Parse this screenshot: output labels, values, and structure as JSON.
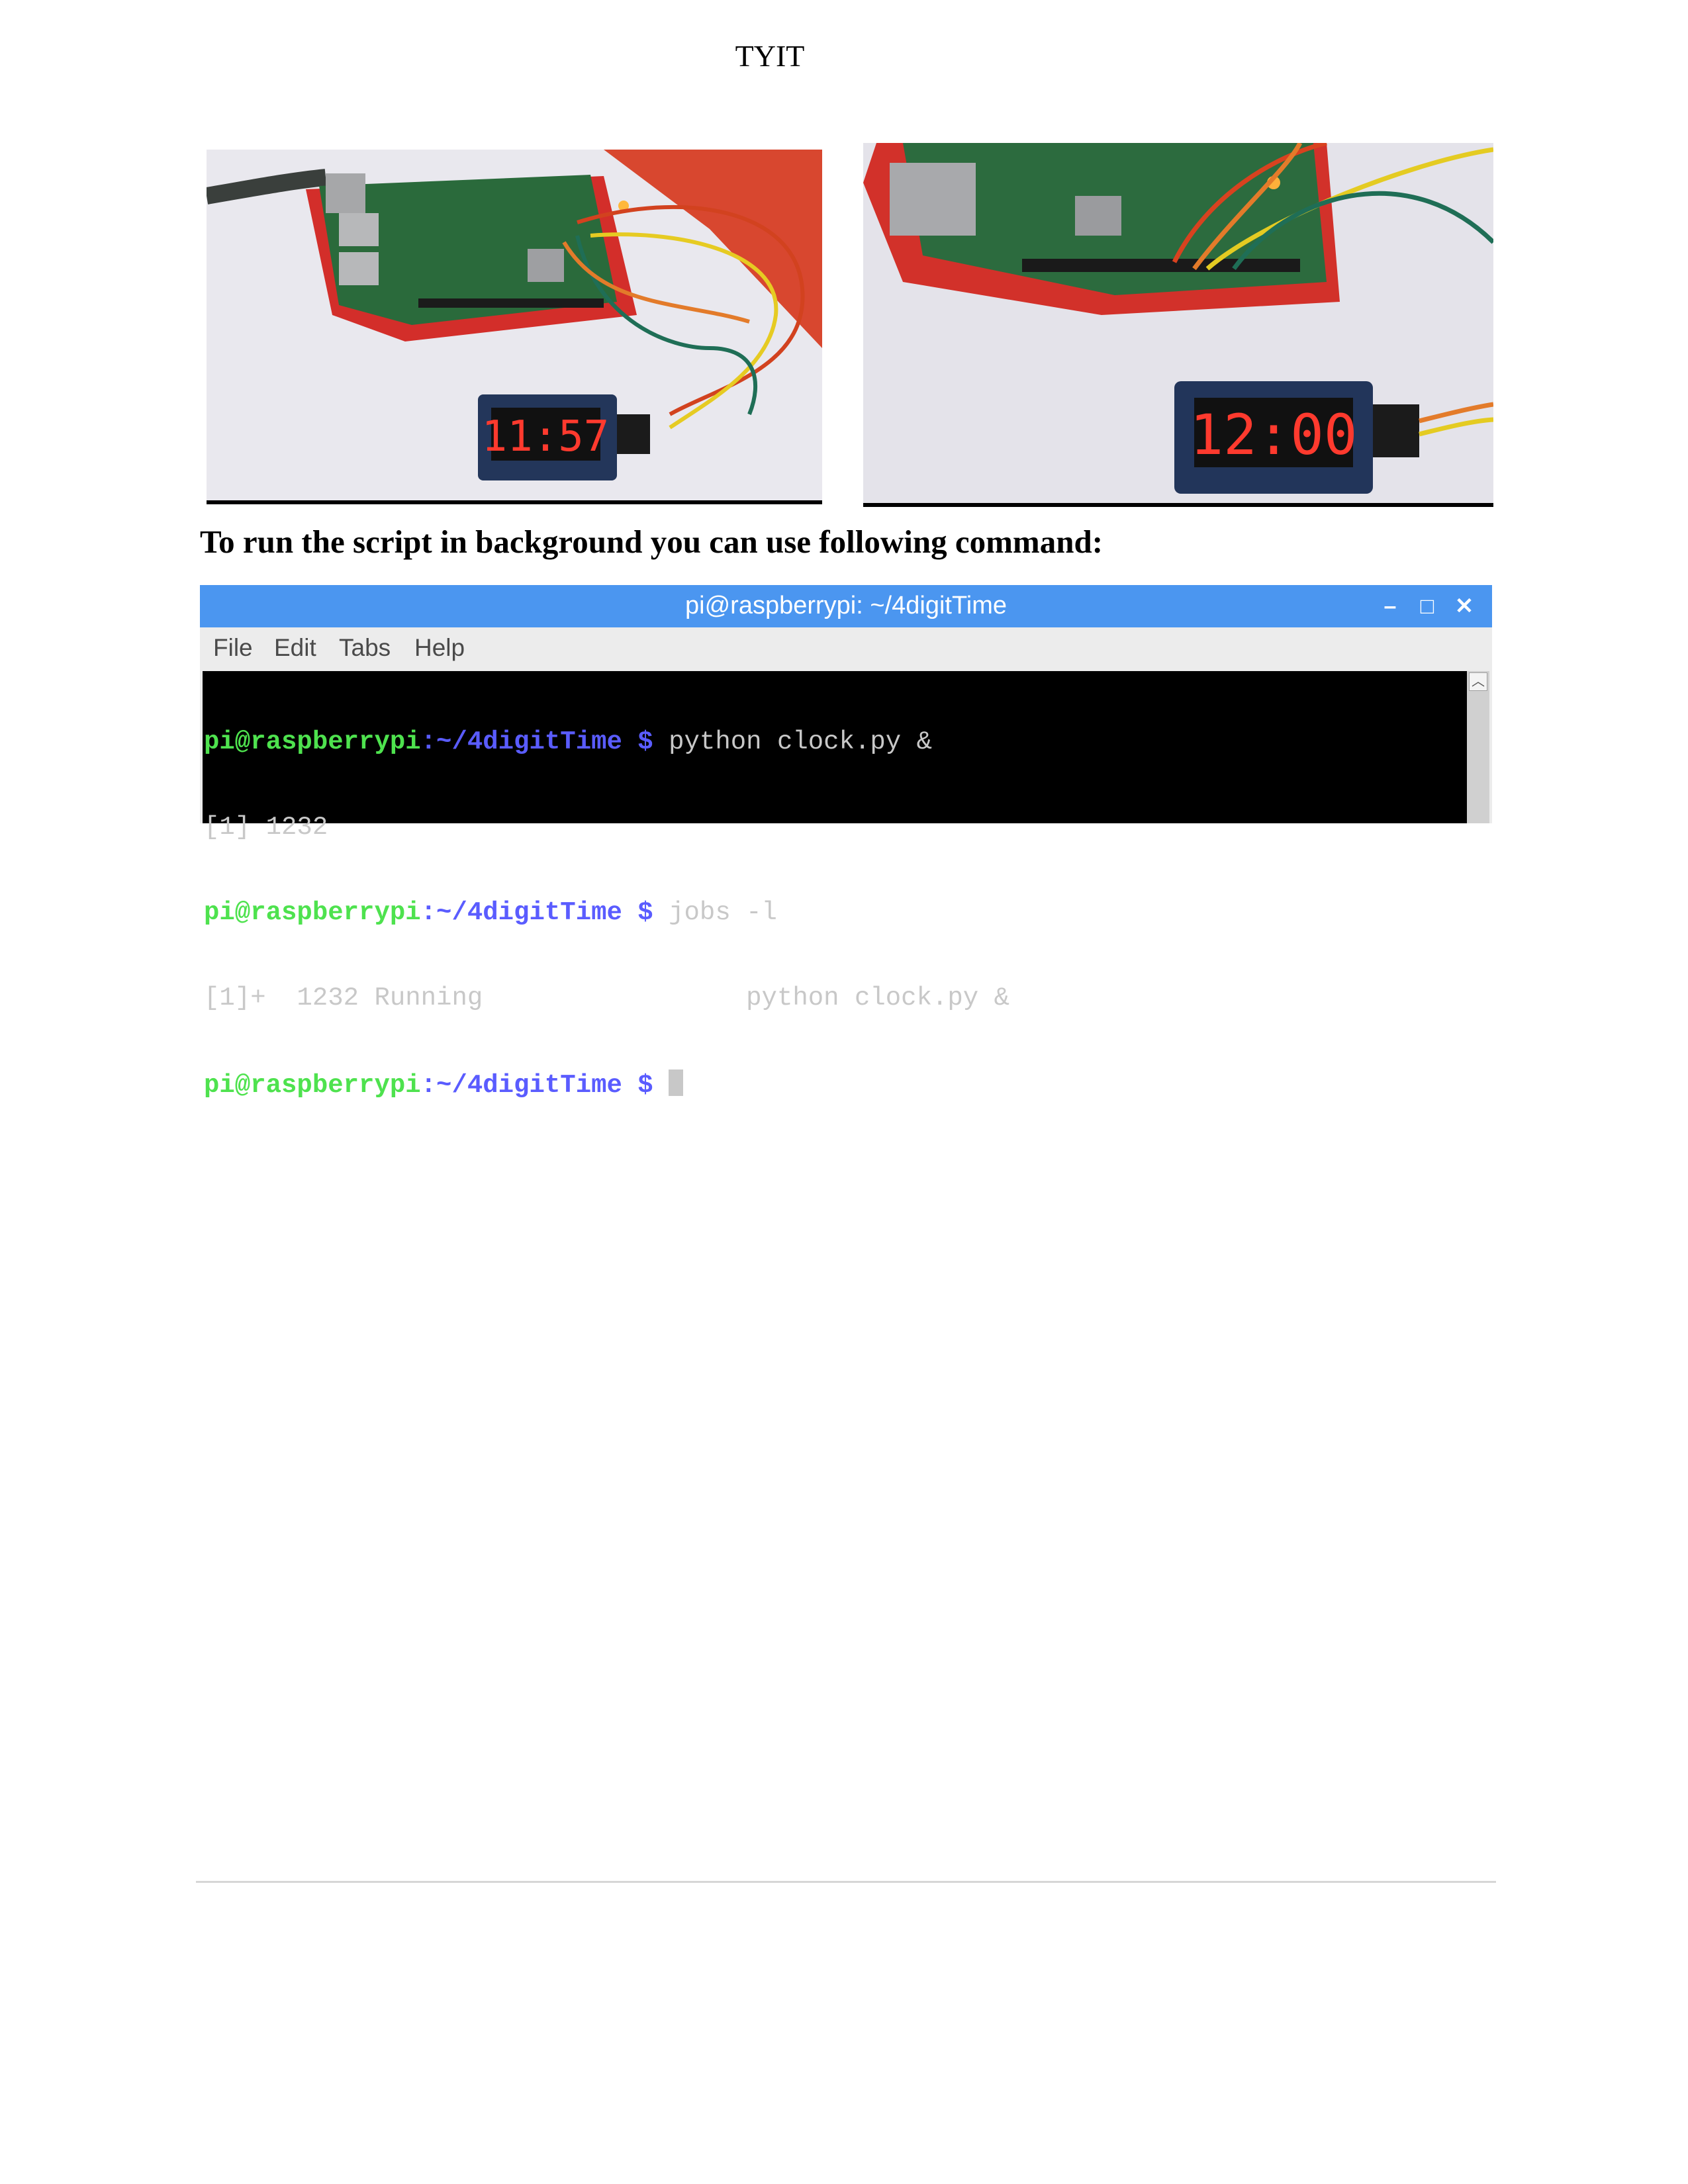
{
  "header": {
    "text": "TYIT"
  },
  "photos": {
    "left": {
      "display": "11:57"
    },
    "right": {
      "display": "12:00"
    }
  },
  "heading": "To run the script in background you can use following command:",
  "terminal": {
    "title": "pi@raspberrypi: ~/4digitTime",
    "controls": {
      "minimize": "–",
      "maximize": "□",
      "close": "✕"
    },
    "menu": [
      "File",
      "Edit",
      "Tabs",
      "Help"
    ],
    "lines": [
      {
        "user": "pi@raspberrypi",
        "path": ":~/4digitTime $ ",
        "cmd": "python clock.py &"
      },
      {
        "out": "[1] 1232"
      },
      {
        "user": "pi@raspberrypi",
        "path": ":~/4digitTime $ ",
        "cmd": "jobs -l"
      },
      {
        "out": "[1]+  1232 Running                 python clock.py &"
      },
      {
        "user": "pi@raspberrypi",
        "path": ":~/4digitTime $ ",
        "cmd": ""
      }
    ],
    "scroll_icon": "chevron-up-icon"
  }
}
